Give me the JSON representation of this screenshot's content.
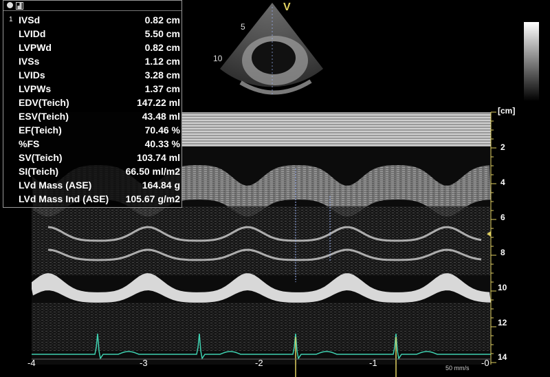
{
  "colors": {
    "ecg": "#3fd0b0",
    "marker": "#e0d060",
    "caliper": "#9fb8ff",
    "panel_border": "#9a9a9a"
  },
  "measurements": {
    "active_index": "1",
    "rows": [
      {
        "name": "IVSd",
        "value": "0.82 cm"
      },
      {
        "name": "LVIDd",
        "value": "5.50 cm"
      },
      {
        "name": "LVPWd",
        "value": "0.82 cm"
      },
      {
        "name": "IVSs",
        "value": "1.12 cm"
      },
      {
        "name": "LVIDs",
        "value": "3.28 cm"
      },
      {
        "name": "LVPWs",
        "value": "1.37 cm"
      },
      {
        "name": "EDV(Teich)",
        "value": "147.22 ml"
      },
      {
        "name": "ESV(Teich)",
        "value": "43.48 ml"
      },
      {
        "name": "EF(Teich)",
        "value": "70.46 %"
      },
      {
        "name": "%FS",
        "value": "40.33 %"
      },
      {
        "name": "SV(Teich)",
        "value": "103.74 ml"
      },
      {
        "name": "SI(Teich)",
        "value": "66.50 ml/m2"
      },
      {
        "name": "LVd Mass (ASE)",
        "value": "164.84 g"
      },
      {
        "name": "LVd Mass Ind (ASE)",
        "value": "105.67 g/m2"
      }
    ]
  },
  "bmode": {
    "orientation_mark": "V",
    "depth_labels": [
      "5",
      "10"
    ]
  },
  "mmode": {
    "depth_unit": "[cm]",
    "depth_ticks": [
      "2",
      "4",
      "6",
      "8",
      "10",
      "12",
      "14"
    ],
    "time_ticks": [
      "-4",
      "-3",
      "-2",
      "-1",
      "-0"
    ],
    "sweep_speed": "50 mm/s"
  }
}
